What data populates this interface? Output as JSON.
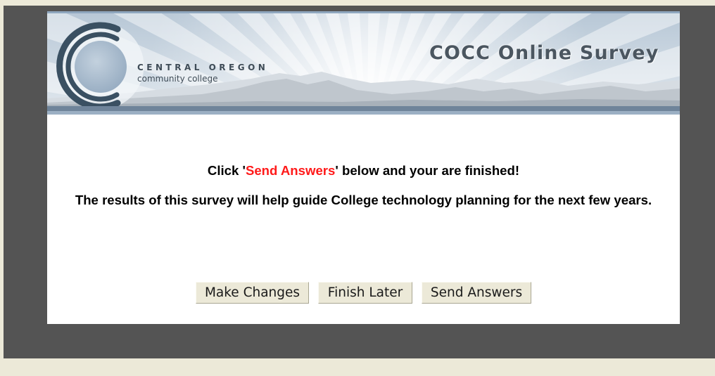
{
  "colors": {
    "page_background": "#ece9d8",
    "frame": "#545454",
    "content_background": "#ffffff",
    "header_text": "#3f4c57",
    "title_text": "#4b5660",
    "highlight": "#ff1a1a",
    "button_background": "#ece9d8"
  },
  "header": {
    "logo": "cocc-logo",
    "college_name_line1": "CENTRAL OREGON",
    "college_name_line2": "community college",
    "survey_title": "COCC Online Survey"
  },
  "message": {
    "line1_prefix": "Click '",
    "line1_highlight": "Send Answers",
    "line1_suffix": "' below and your are finished!",
    "line2": "The results of this survey will help guide College technology planning for the next few years."
  },
  "buttons": {
    "make_changes": "Make Changes",
    "finish_later": "Finish Later",
    "send_answers": "Send Answers"
  }
}
